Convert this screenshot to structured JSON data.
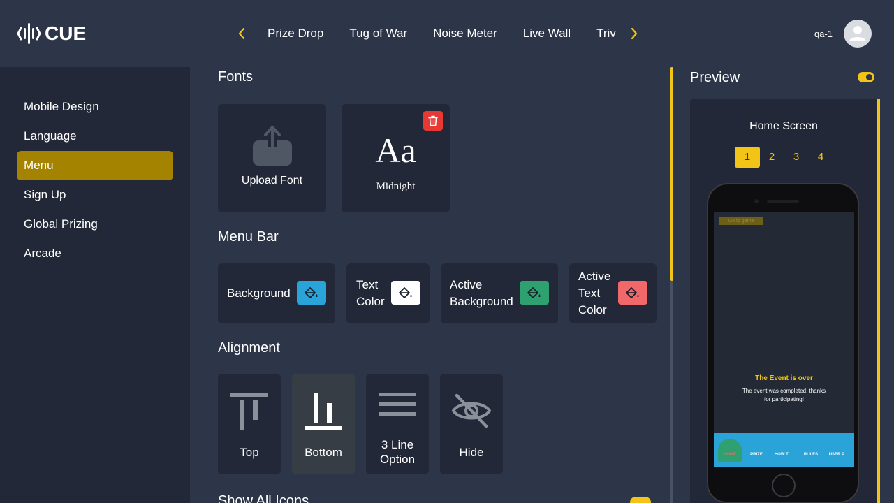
{
  "brand": {
    "name": "CUE"
  },
  "header": {
    "tabs": [
      "Prize Drop",
      "Tug of War",
      "Noise Meter",
      "Live Wall",
      "Trivia"
    ],
    "user_name": "qa-1"
  },
  "sidebar": {
    "items": [
      "Mobile Design",
      "Language",
      "Menu",
      "Sign Up",
      "Global Prizing",
      "Arcade"
    ],
    "active": "Menu"
  },
  "fonts": {
    "title": "Fonts",
    "upload_label": "Upload Font",
    "sample_glyph": "Aa",
    "font_name": "Midnight"
  },
  "menu_bar": {
    "title": "Menu Bar",
    "items": [
      {
        "label": "Background",
        "color": "#2aa3d8"
      },
      {
        "label": "Text Color",
        "color": "#ffffff"
      },
      {
        "label": "Active Background",
        "color": "#2fa070"
      },
      {
        "label": "Active Text Color",
        "color": "#f0686a"
      }
    ]
  },
  "alignment": {
    "title": "Alignment",
    "options": [
      "Top",
      "Bottom",
      "3 Line Option",
      "Hide"
    ],
    "selected": "Bottom"
  },
  "show_all_icons": {
    "title": "Show All Icons"
  },
  "preview": {
    "title": "Preview",
    "screen_title": "Home Screen",
    "pages": [
      "1",
      "2",
      "3",
      "4"
    ],
    "active_page": "1",
    "phone": {
      "go_to_game": "Go to game",
      "event_title": "The Event is over",
      "event_message": "The event was completed, thanks for participating!",
      "nav": [
        "HOME",
        "PRIZE",
        "HOW T...",
        "RULES",
        "USER P..."
      ]
    }
  },
  "colors": {
    "accent": "#f2c418",
    "sidebar_active": "#a48300",
    "danger": "#e53935"
  }
}
